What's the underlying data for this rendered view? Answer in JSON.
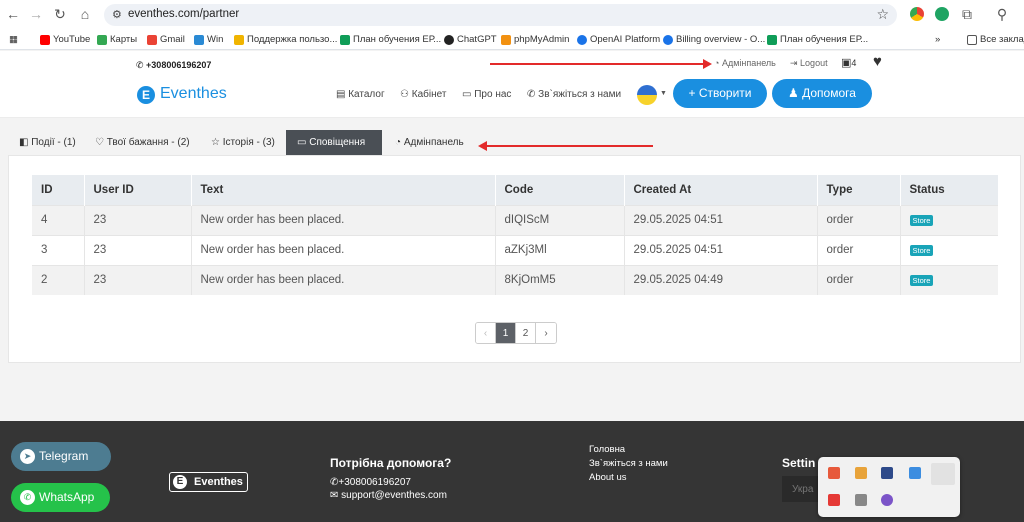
{
  "browser": {
    "url": "eventhes.com/partner",
    "bookmarks": [
      "YouTube",
      "Карты",
      "Gmail",
      "Win",
      "Поддержка пользо...",
      "План обучения ЕР...",
      "ChatGPT",
      "phpMyAdmin",
      "OpenAI Platform",
      "Billing overview - O...",
      "План обучения ЕР..."
    ],
    "all_bookmarks": "Все заклад"
  },
  "topbar": {
    "phone": "+308006196207",
    "admin": "Адмінпанель",
    "logout": "Logout",
    "calendar_count": "4"
  },
  "header": {
    "logo_letter": "E",
    "logo_text": "Eventhes",
    "menu": [
      "Каталог",
      "Кабінет",
      "Про нас",
      "Зв`яжіться з нами"
    ],
    "create_button": "+ Створити",
    "help_button": "Допомога"
  },
  "tabs": [
    "Події - (1)",
    "Твої бажання - (2)",
    "Історія - (3)",
    "Сповіщення",
    "Адмінпанель"
  ],
  "table": {
    "headers": [
      "ID",
      "User ID",
      "Text",
      "Code",
      "Created At",
      "Type",
      "Status"
    ],
    "rows": [
      [
        "4",
        "23",
        "New order has been placed.",
        "dIQIScM",
        "29.05.2025 04:51",
        "order",
        "Store"
      ],
      [
        "3",
        "23",
        "New order has been placed.",
        "aZKj3Ml",
        "29.05.2025 04:51",
        "order",
        "Store"
      ],
      [
        "2",
        "23",
        "New order has been placed.",
        "8KjOmM5",
        "29.05.2025 04:49",
        "order",
        "Store"
      ]
    ]
  },
  "pagination": [
    "‹",
    "1",
    "2",
    "›"
  ],
  "footer": {
    "telegram": "Telegram",
    "whatsapp": "WhatsApp",
    "logo_text": "Eventhes",
    "help_title": "Потрібна допомога?",
    "phone": "+308006196207",
    "email": "support@eventhes.com",
    "links": [
      "Головна",
      "Зв`яжіться з нами",
      "About us"
    ],
    "settings": "Settin",
    "input_placeholder": "Укра"
  },
  "colors": {
    "accent": "#1a8fe0",
    "badge": "#19a4b8",
    "footer": "#353535",
    "arrow": "#e32a2a"
  }
}
